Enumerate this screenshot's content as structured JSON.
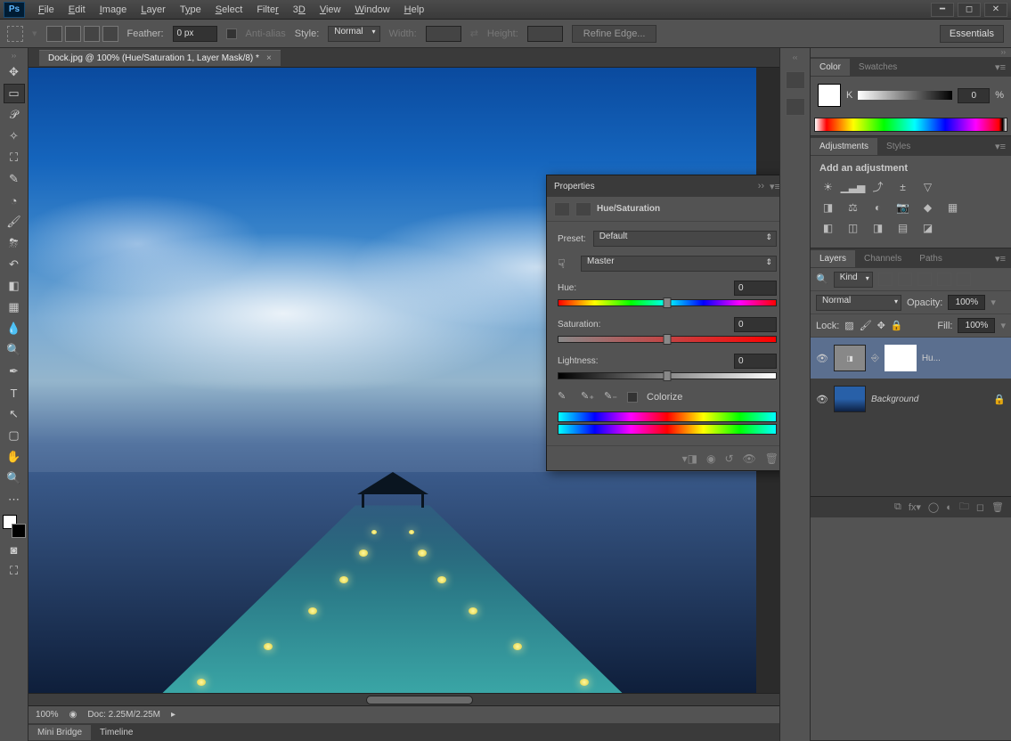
{
  "menu": [
    "File",
    "Edit",
    "Image",
    "Layer",
    "Type",
    "Select",
    "Filter",
    "3D",
    "View",
    "Window",
    "Help"
  ],
  "options": {
    "feather_label": "Feather:",
    "feather_value": "0 px",
    "antialias": "Anti-alias",
    "style_label": "Style:",
    "style_value": "Normal",
    "width_label": "Width:",
    "height_label": "Height:",
    "refine": "Refine Edge...",
    "workspace": "Essentials"
  },
  "doc": {
    "tab": "Dock.jpg @ 100% (Hue/Saturation 1, Layer Mask/8) *",
    "zoom": "100%",
    "docinfo": "Doc: 2.25M/2.25M"
  },
  "bottom_tabs": {
    "mini": "Mini Bridge",
    "timeline": "Timeline"
  },
  "color_panel": {
    "tabs": [
      "Color",
      "Swatches"
    ],
    "k_label": "K",
    "k_value": "0",
    "pct": "%"
  },
  "adjustments_panel": {
    "tabs": [
      "Adjustments",
      "Styles"
    ],
    "hint": "Add an adjustment"
  },
  "layers_panel": {
    "tabs": [
      "Layers",
      "Channels",
      "Paths"
    ],
    "kind": "Kind",
    "mode": "Normal",
    "opacity_label": "Opacity:",
    "opacity": "100%",
    "lock_label": "Lock:",
    "fill_label": "Fill:",
    "fill": "100%",
    "layers": [
      {
        "name": "Hu...",
        "type": "adj",
        "selected": true
      },
      {
        "name": "Background",
        "type": "img",
        "locked": true
      }
    ]
  },
  "props": {
    "title": "Properties",
    "name": "Hue/Saturation",
    "preset_label": "Preset:",
    "preset": "Default",
    "channel": "Master",
    "hue_label": "Hue:",
    "hue": "0",
    "sat_label": "Saturation:",
    "sat": "0",
    "light_label": "Lightness:",
    "light": "0",
    "colorize": "Colorize"
  }
}
